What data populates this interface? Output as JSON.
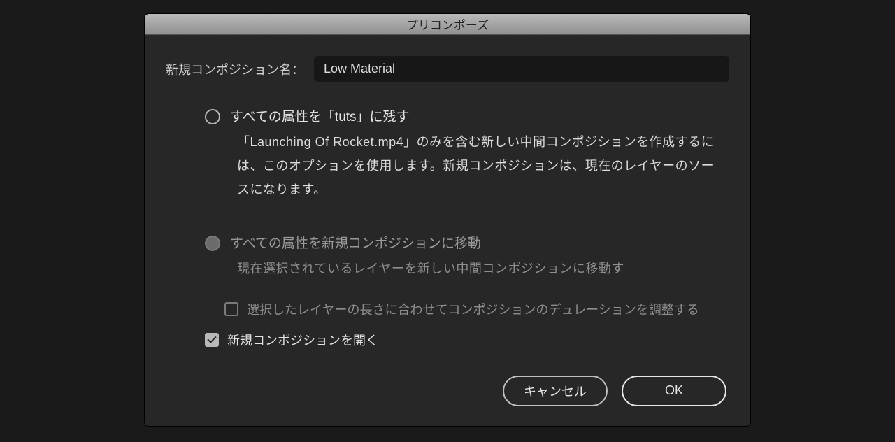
{
  "dialog": {
    "title": "プリコンポーズ",
    "name_label": "新規コンポジション名：",
    "name_value": "Low Material",
    "option1": {
      "title": "すべての属性を「tuts」に残す",
      "desc": "「Launching Of Rocket.mp4」のみを含む新しい中間コンポジションを作成するには、このオプションを使用します。新規コンポジションは、現在のレイヤーのソースになります。"
    },
    "option2": {
      "title": "すべての属性を新規コンポジションに移動",
      "desc": "現在選択されているレイヤーを新しい中間コンポジションに移動す"
    },
    "adjust_duration_label": "選択したレイヤーの長さに合わせてコンポジションのデュレーションを調整する",
    "open_new_label": "新規コンポジションを開く",
    "cancel": "キャンセル",
    "ok": "OK"
  }
}
